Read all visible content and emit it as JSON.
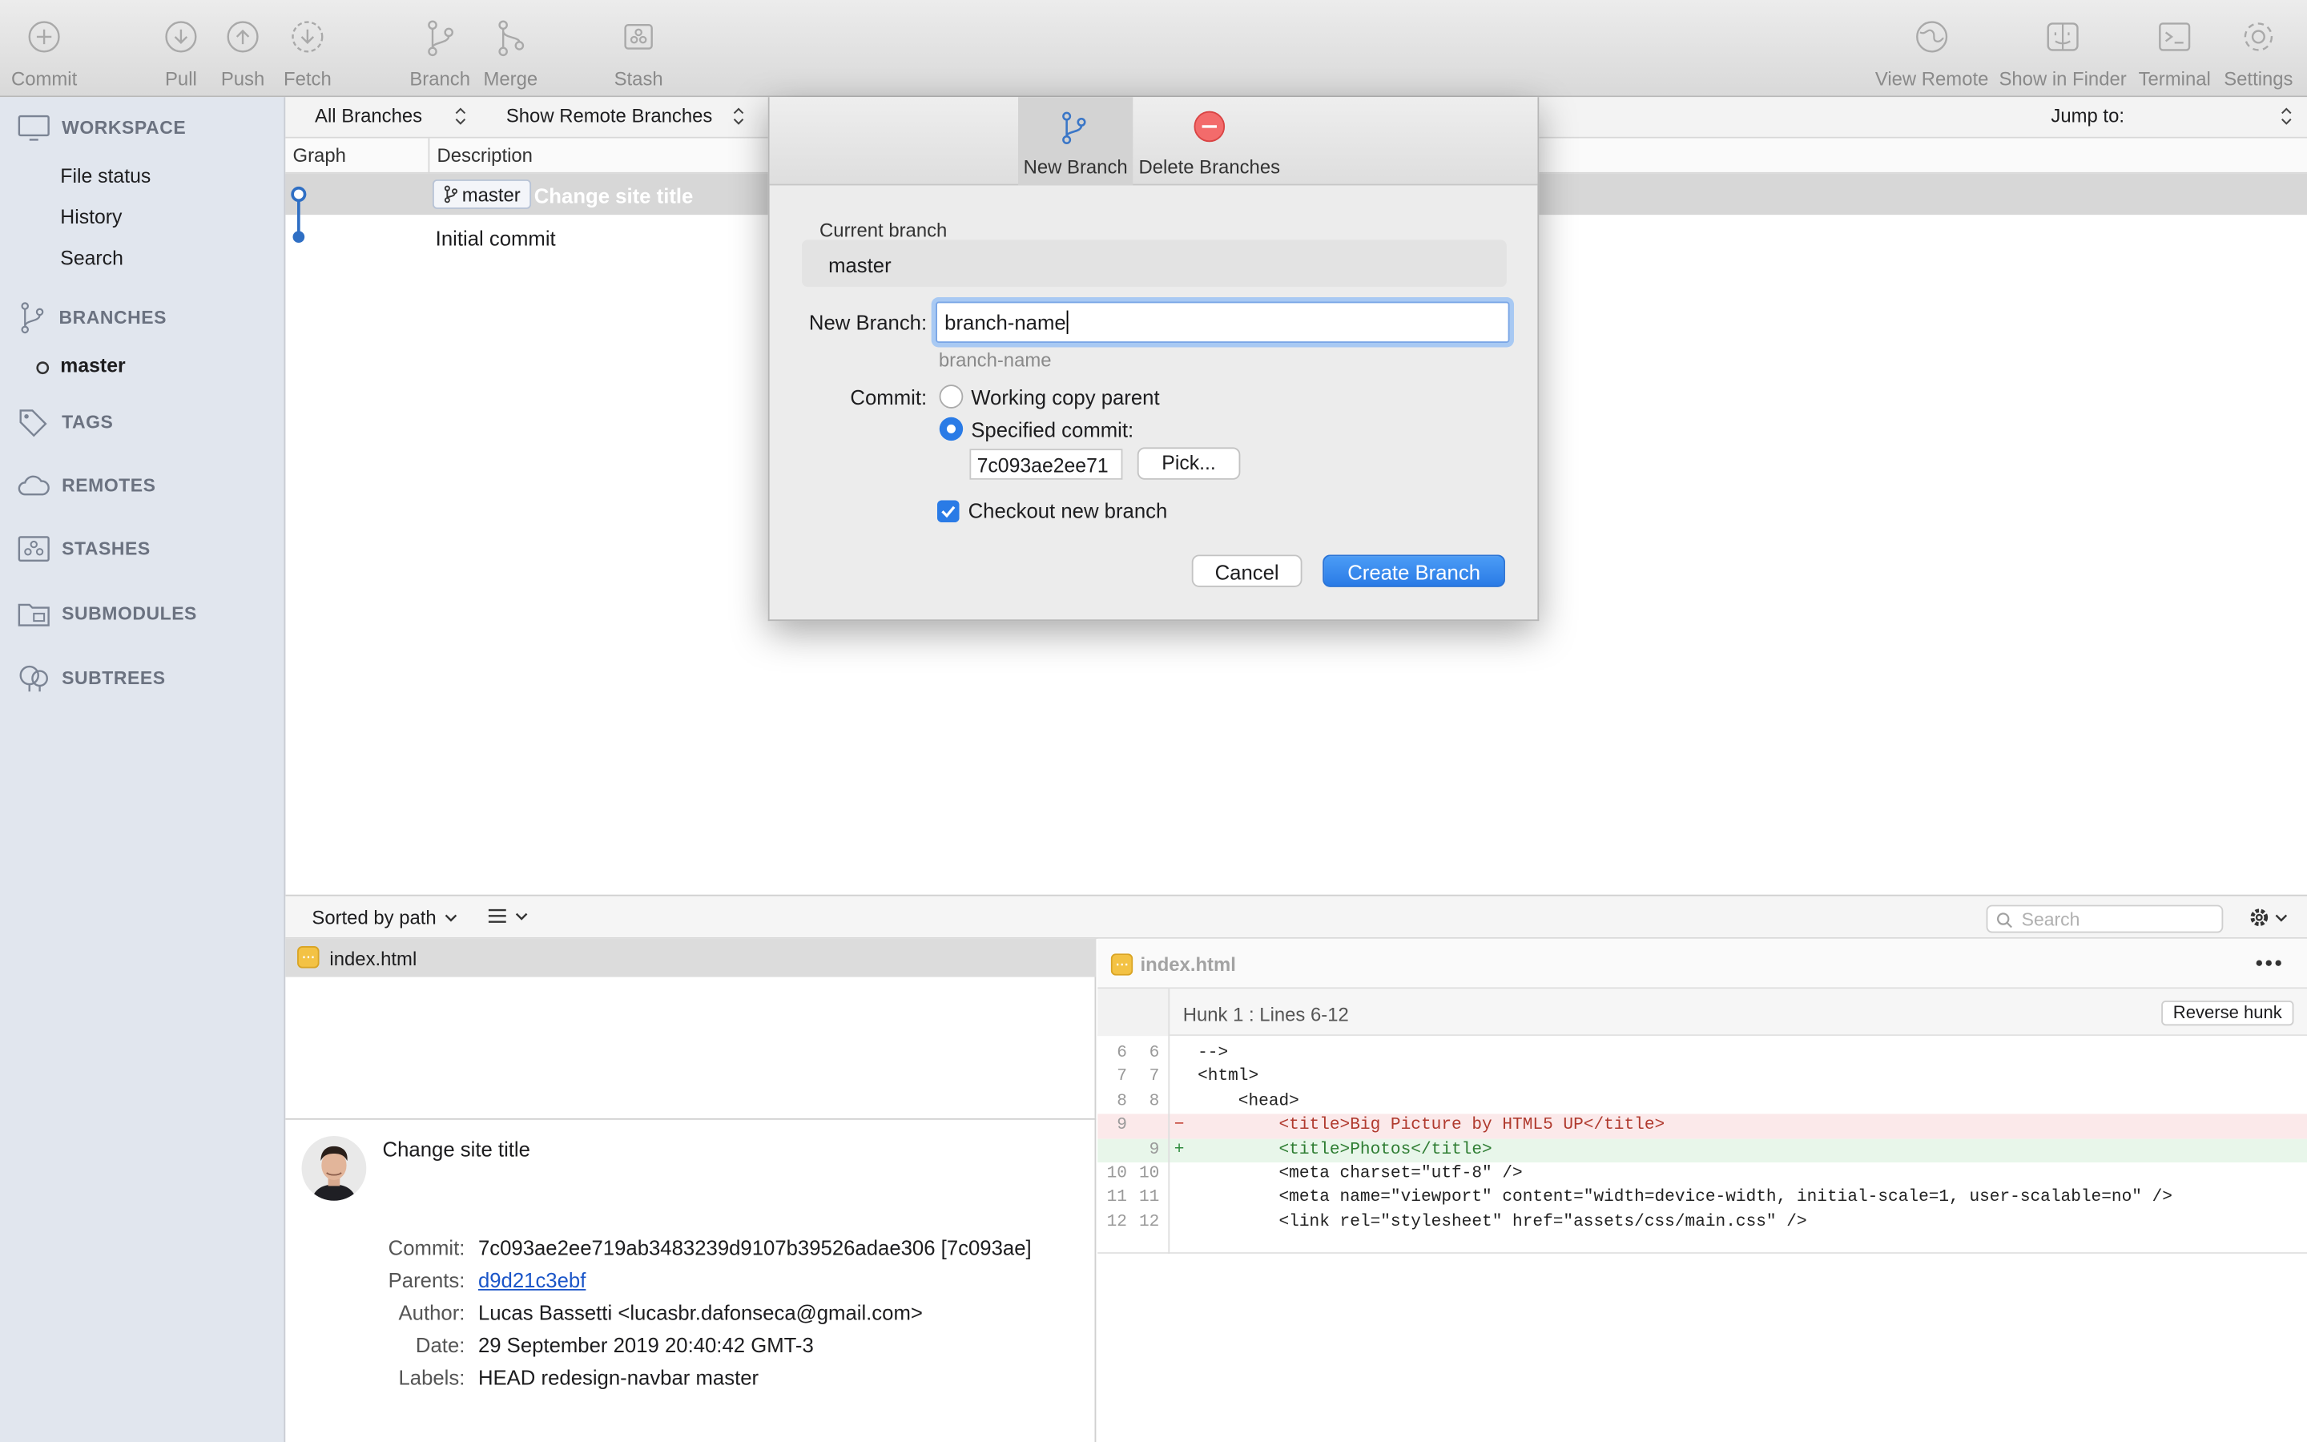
{
  "toolbar": {
    "commit": "Commit",
    "pull": "Pull",
    "push": "Push",
    "fetch": "Fetch",
    "branch": "Branch",
    "merge": "Merge",
    "stash": "Stash",
    "view_remote": "View Remote",
    "show_in_finder": "Show in Finder",
    "terminal": "Terminal",
    "settings": "Settings"
  },
  "sidebar": {
    "workspace": "WORKSPACE",
    "file_status": "File status",
    "history": "History",
    "search": "Search",
    "branches": "BRANCHES",
    "master": "master",
    "tags": "TAGS",
    "remotes": "REMOTES",
    "stashes": "STASHES",
    "submodules": "SUBMODULES",
    "subtrees": "SUBTREES"
  },
  "filterbar": {
    "branches_select": "All Branches",
    "remote_select": "Show Remote Branches",
    "jump_to": "Jump to:"
  },
  "log": {
    "col_graph": "Graph",
    "col_description": "Description",
    "rows": [
      {
        "branch_tag": "master",
        "message": "Change site title"
      },
      {
        "message": "Initial commit"
      }
    ]
  },
  "files": {
    "sort_label": "Sorted by path",
    "search_placeholder": "Search",
    "file_name": "index.html"
  },
  "commit_details": {
    "title": "Change site title",
    "commit_label": "Commit:",
    "commit_value": "7c093ae2ee719ab3483239d9107b39526adae306 [7c093ae]",
    "parents_label": "Parents:",
    "parents_value": "d9d21c3ebf",
    "author_label": "Author:",
    "author_value": "Lucas Bassetti <lucasbr.dafonseca@gmail.com>",
    "date_label": "Date:",
    "date_value": "29 September 2019 20:40:42 GMT-3",
    "labels_label": "Labels:",
    "labels_value": "HEAD redesign-navbar master"
  },
  "diff": {
    "file_name": "index.html",
    "hunk_title": "Hunk 1 : Lines 6-12",
    "reverse_hunk": "Reverse hunk",
    "lines": [
      {
        "old": "6",
        "new": "6",
        "sign": "",
        "text": "-->"
      },
      {
        "old": "7",
        "new": "7",
        "sign": "",
        "text": "<html>"
      },
      {
        "old": "8",
        "new": "8",
        "sign": "",
        "text": "    <head>"
      },
      {
        "old": "9",
        "new": "",
        "sign": "−",
        "text": "        <title>Big Picture by HTML5 UP</title>"
      },
      {
        "old": "",
        "new": "9",
        "sign": "+",
        "text": "        <title>Photos</title>"
      },
      {
        "old": "10",
        "new": "10",
        "sign": "",
        "text": "        <meta charset=\"utf-8\" />"
      },
      {
        "old": "11",
        "new": "11",
        "sign": "",
        "text": "        <meta name=\"viewport\" content=\"width=device-width, initial-scale=1, user-scalable=no\" />"
      },
      {
        "old": "12",
        "new": "12",
        "sign": "",
        "text": "        <link rel=\"stylesheet\" href=\"assets/css/main.css\" />"
      }
    ]
  },
  "dialog": {
    "tab_new_branch": "New Branch",
    "tab_delete_branches": "Delete Branches",
    "current_branch_label": "Current branch",
    "current_branch_value": "master",
    "new_branch_label": "New Branch:",
    "new_branch_value": "branch-name",
    "new_branch_hint": "branch-name",
    "commit_label": "Commit:",
    "option_working_copy": "Working copy parent",
    "option_specified": "Specified commit:",
    "specified_commit_value": "7c093ae2ee71",
    "pick_button": "Pick...",
    "checkout_label": "Checkout new branch",
    "cancel_button": "Cancel",
    "create_button": "Create Branch"
  },
  "colors": {
    "accent": "#2a7be6",
    "removed_bg": "#fbe9ea",
    "added_bg": "#e8f6ea",
    "graph": "#2f6fc4"
  }
}
